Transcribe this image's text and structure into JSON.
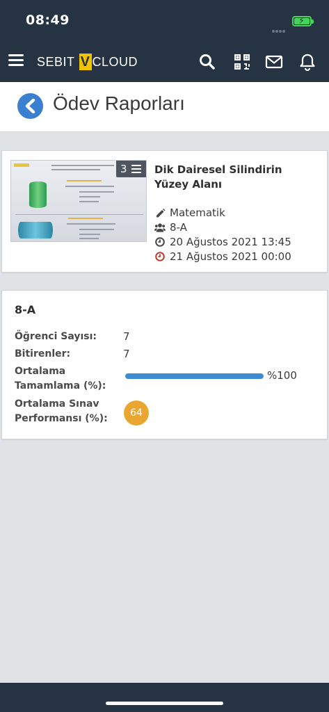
{
  "status_bar": {
    "time": "08:49"
  },
  "nav": {
    "logo_left": "SEBIT",
    "logo_v": "V",
    "logo_right": "CLOUD",
    "icons": [
      "menu-icon",
      "search-icon",
      "qr-code-icon",
      "mail-icon",
      "bell-icon"
    ]
  },
  "page": {
    "title": "Ödev Raporları"
  },
  "assignment": {
    "title": "Dik Dairesel Silindirin Yüzey Alanı",
    "page_count": "3",
    "subject": "Matematik",
    "class": "8-A",
    "start_date": "20 Ağustos 2021 13:45",
    "due_date": "21 Ağustos 2021 00:00"
  },
  "report": {
    "class_name": "8-A",
    "student_count_label": "Öğrenci Sayısı:",
    "student_count": "7",
    "finished_label": "Bitirenler:",
    "finished": "7",
    "completion_label": "Ortalama Tamamlama (%):",
    "completion_text": "%100",
    "completion_value": 100,
    "exam_label": "Ortalama Sınav Performansı (%):",
    "exam_score": "64"
  },
  "colors": {
    "navbar": "#253343",
    "accent_blue": "#3a7fd0",
    "progress": "#3d8bd0",
    "score_badge": "#e9a631",
    "due_icon": "#c0392b"
  }
}
